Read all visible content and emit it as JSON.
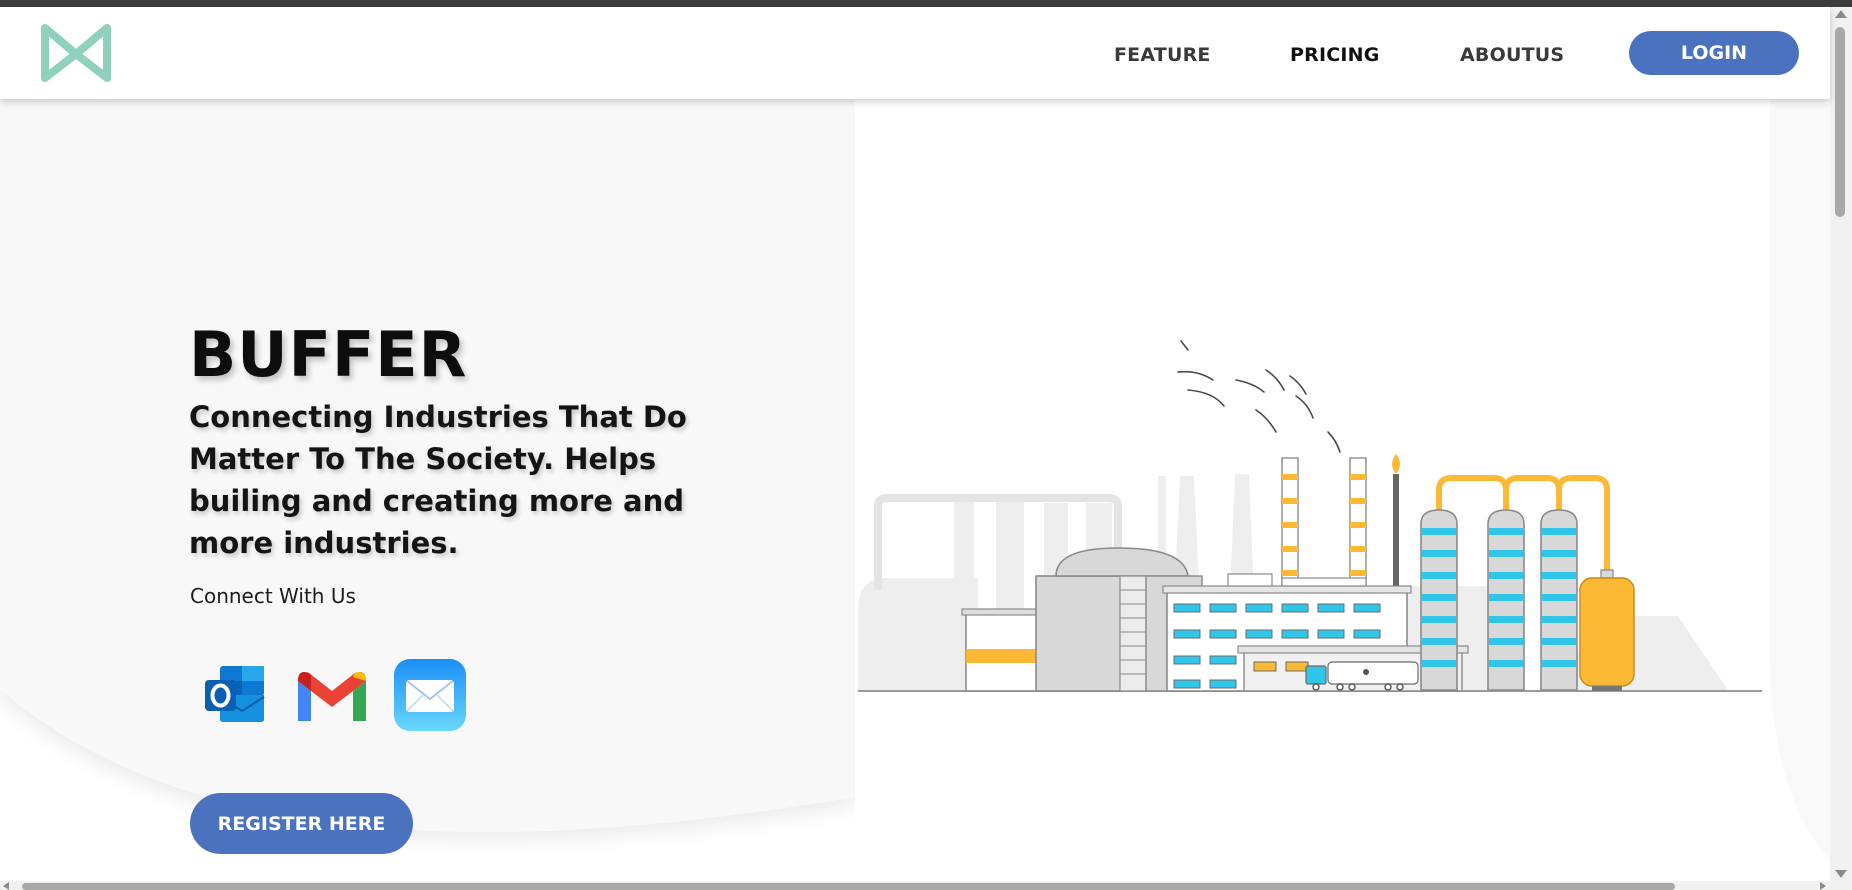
{
  "header": {
    "logo_icon": "m-bowtie-logo-icon",
    "nav": {
      "feature": "FEATURE",
      "pricing": "PRICING",
      "aboutus": "ABOUTUS"
    },
    "login_label": "LOGIN"
  },
  "hero": {
    "title": "BUFFER",
    "tagline": "Connecting Industries That Do Matter To The Society. Helps builing and creating more and more industries.",
    "connect_label": "Connect With Us",
    "social_icons": [
      "outlook-icon",
      "gmail-icon",
      "mail-icon"
    ],
    "register_label": "REGISTER HERE",
    "illustration": "factory-illustration"
  },
  "colors": {
    "accent": "#4a72bf",
    "logo": "#8fd1bd",
    "factory_orange": "#fbb935",
    "factory_cyan": "#2fc6ea",
    "hero_background": "#f9f9f9"
  }
}
